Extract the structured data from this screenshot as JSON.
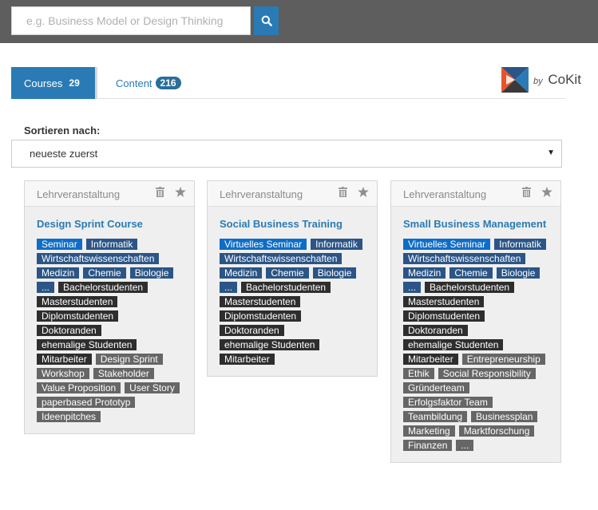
{
  "search": {
    "placeholder": "e.g. Business Model or Design Thinking"
  },
  "tabs": [
    {
      "label": "Courses",
      "count": "29"
    },
    {
      "label": "Content",
      "count": "216"
    }
  ],
  "brand": {
    "by": "by",
    "name": "CoKit"
  },
  "sort": {
    "label": "Sortieren nach:",
    "value": "neueste zuerst"
  },
  "colors": {
    "accent": "#2a7bb5",
    "tag_blue": "#0d6dc7",
    "tag_navy": "#2b5586",
    "tag_dark": "#2e2e2e",
    "tag_gray": "#666666"
  },
  "cards": [
    {
      "type": "Lehrveranstaltung",
      "title": "Design Sprint Course",
      "tags": [
        {
          "text": "Seminar",
          "kind": "blue"
        },
        {
          "text": "Informatik",
          "kind": "navy"
        },
        {
          "text": "Wirtschaftswissenschaften",
          "kind": "navy"
        },
        {
          "text": "Medizin",
          "kind": "navy"
        },
        {
          "text": "Chemie",
          "kind": "navy"
        },
        {
          "text": "Biologie",
          "kind": "navy"
        },
        {
          "text": "...",
          "kind": "navy"
        },
        {
          "text": "Bachelorstudenten",
          "kind": "dark"
        },
        {
          "text": "Masterstudenten",
          "kind": "dark"
        },
        {
          "text": "Diplomstudenten",
          "kind": "dark"
        },
        {
          "text": "Doktoranden",
          "kind": "dark"
        },
        {
          "text": "ehemalige Studenten",
          "kind": "dark"
        },
        {
          "text": "Mitarbeiter",
          "kind": "dark"
        },
        {
          "text": "Design Sprint",
          "kind": "gray"
        },
        {
          "text": "Workshop",
          "kind": "gray"
        },
        {
          "text": "Stakeholder",
          "kind": "gray"
        },
        {
          "text": "Value Proposition",
          "kind": "gray"
        },
        {
          "text": "User Story",
          "kind": "gray"
        },
        {
          "text": "paperbased Prototyp",
          "kind": "gray"
        },
        {
          "text": "Ideenpitches",
          "kind": "gray"
        }
      ]
    },
    {
      "type": "Lehrveranstaltung",
      "title": "Social Business Training",
      "tags": [
        {
          "text": "Virtuelles Seminar",
          "kind": "blue"
        },
        {
          "text": "Informatik",
          "kind": "navy"
        },
        {
          "text": "Wirtschaftswissenschaften",
          "kind": "navy"
        },
        {
          "text": "Medizin",
          "kind": "navy"
        },
        {
          "text": "Chemie",
          "kind": "navy"
        },
        {
          "text": "Biologie",
          "kind": "navy"
        },
        {
          "text": "...",
          "kind": "navy"
        },
        {
          "text": "Bachelorstudenten",
          "kind": "dark"
        },
        {
          "text": "Masterstudenten",
          "kind": "dark"
        },
        {
          "text": "Diplomstudenten",
          "kind": "dark"
        },
        {
          "text": "Doktoranden",
          "kind": "dark"
        },
        {
          "text": "ehemalige Studenten",
          "kind": "dark"
        },
        {
          "text": "Mitarbeiter",
          "kind": "dark"
        }
      ]
    },
    {
      "type": "Lehrveranstaltung",
      "title": "Small Business Management",
      "tags": [
        {
          "text": "Virtuelles Seminar",
          "kind": "blue"
        },
        {
          "text": "Informatik",
          "kind": "navy"
        },
        {
          "text": "Wirtschaftswissenschaften",
          "kind": "navy"
        },
        {
          "text": "Medizin",
          "kind": "navy"
        },
        {
          "text": "Chemie",
          "kind": "navy"
        },
        {
          "text": "Biologie",
          "kind": "navy"
        },
        {
          "text": "...",
          "kind": "navy"
        },
        {
          "text": "Bachelorstudenten",
          "kind": "dark"
        },
        {
          "text": "Masterstudenten",
          "kind": "dark"
        },
        {
          "text": "Diplomstudenten",
          "kind": "dark"
        },
        {
          "text": "Doktoranden",
          "kind": "dark"
        },
        {
          "text": "ehemalige Studenten",
          "kind": "dark"
        },
        {
          "text": "Mitarbeiter",
          "kind": "dark"
        },
        {
          "text": "Entrepreneurship",
          "kind": "gray"
        },
        {
          "text": "Ethik",
          "kind": "gray"
        },
        {
          "text": "Social Responsibility",
          "kind": "gray"
        },
        {
          "text": "Gründerteam",
          "kind": "gray"
        },
        {
          "text": "Erfolgsfaktor Team",
          "kind": "gray"
        },
        {
          "text": "Teambildung",
          "kind": "gray"
        },
        {
          "text": "Businessplan",
          "kind": "gray"
        },
        {
          "text": "Marketing",
          "kind": "gray"
        },
        {
          "text": "Marktforschung",
          "kind": "gray"
        },
        {
          "text": "Finanzen",
          "kind": "gray"
        },
        {
          "text": "...",
          "kind": "gray"
        }
      ]
    }
  ]
}
